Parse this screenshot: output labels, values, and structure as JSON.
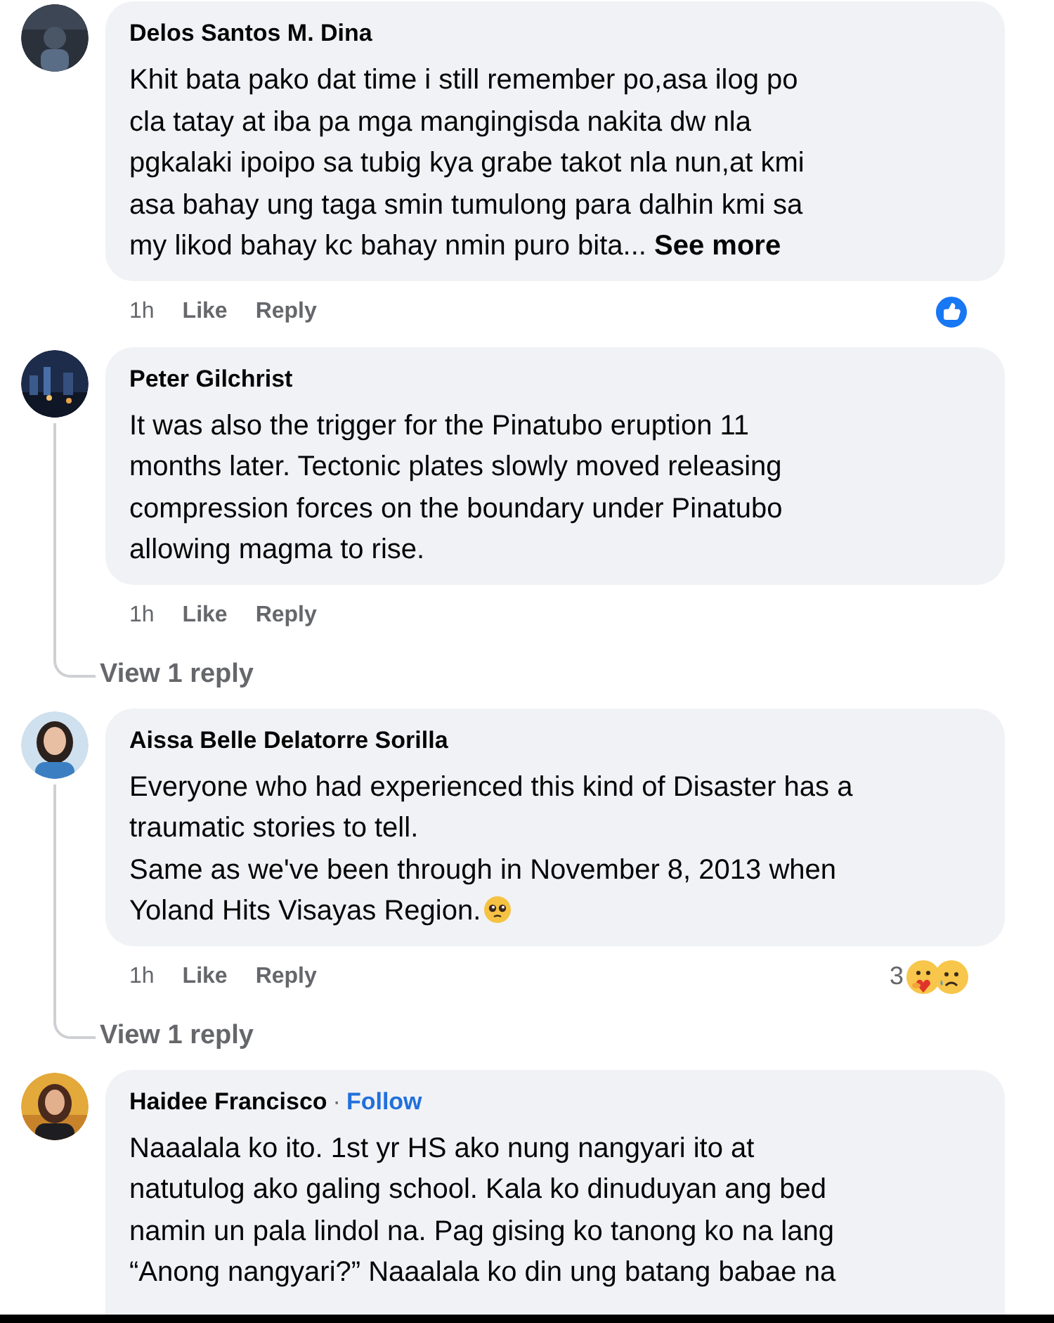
{
  "comments": [
    {
      "author": "Delos Santos M. Dina",
      "text": "Khit bata pako dat time i still remember po,asa ilog po\ncla tatay at iba pa mga mangingisda nakita dw nla\npgkalaki ipoipo sa tubig kya grabe takot nla nun,at kmi\nasa bahay ung taga smin tumulong para dalhin kmi sa\nmy likod bahay kc bahay nmin puro bita...",
      "see_more": "See more",
      "time": "1h",
      "actions": [
        "Like",
        "Reply"
      ],
      "reactions": [
        {
          "kind": "like"
        }
      ]
    },
    {
      "author": "Peter Gilchrist",
      "text": "It was also the trigger for the Pinatubo eruption 11\nmonths later. Tectonic plates slowly moved releasing\ncompression forces on the boundary under Pinatubo\nallowing magma to rise.",
      "time": "1h",
      "actions": [
        "Like",
        "Reply"
      ],
      "replies_link": "View 1 reply"
    },
    {
      "author": "Aissa Belle Delatorre Sorilla",
      "text": "Everyone who had experienced this kind of Disaster has a\ntraumatic stories to tell.\nSame as we've been through in November 8, 2013 when\nYoland Hits Visayas Region.",
      "emoji": {
        "kind": "pleading"
      },
      "time": "1h",
      "actions": [
        "Like",
        "Reply"
      ],
      "reaction_count": "3",
      "reactions": [
        {
          "kind": "care"
        },
        {
          "kind": "sad"
        }
      ],
      "replies_link": "View 1 reply"
    },
    {
      "author": "Haidee Francisco",
      "separator": "·",
      "follow": "Follow",
      "text": "Naaalala ko ito. 1st yr HS ako nung nangyari ito at\nnatutulog ako galing school. Kala ko dinuduyan ang bed\nnamin un pala lindol na. Pag gising ko tanong ko na lang\n“Anong nangyari?” Naaalala ko din ung batang babae na"
    }
  ]
}
